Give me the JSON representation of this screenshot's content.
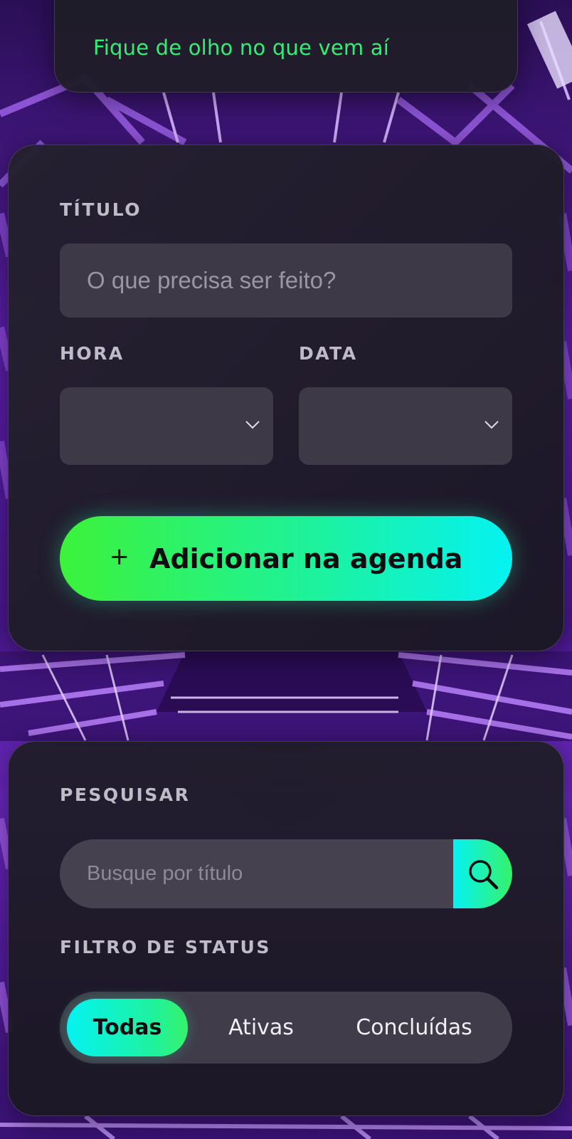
{
  "header": {
    "tagline": "Fique de olho no que vem aí"
  },
  "form": {
    "title_label": "TÍTULO",
    "title_placeholder": "O que precisa ser feito?",
    "hour_label": "HORA",
    "date_label": "DATA",
    "hour_value": "",
    "date_value": "",
    "add_button_icon": "+",
    "add_button_label": "Adicionar na agenda"
  },
  "filters": {
    "search_label": "PESQUISAR",
    "search_placeholder": "Busque por título",
    "search_icon": "search-icon",
    "status_label": "FILTRO DE STATUS",
    "status_options": [
      "Todas",
      "Ativas",
      "Concluídas"
    ],
    "status_selected": "Todas"
  },
  "colors": {
    "accent_green": "#32ee74",
    "accent_cyan": "#05f2f2",
    "panel_bg": "#1f1d29",
    "field_bg": "#3d3947"
  }
}
